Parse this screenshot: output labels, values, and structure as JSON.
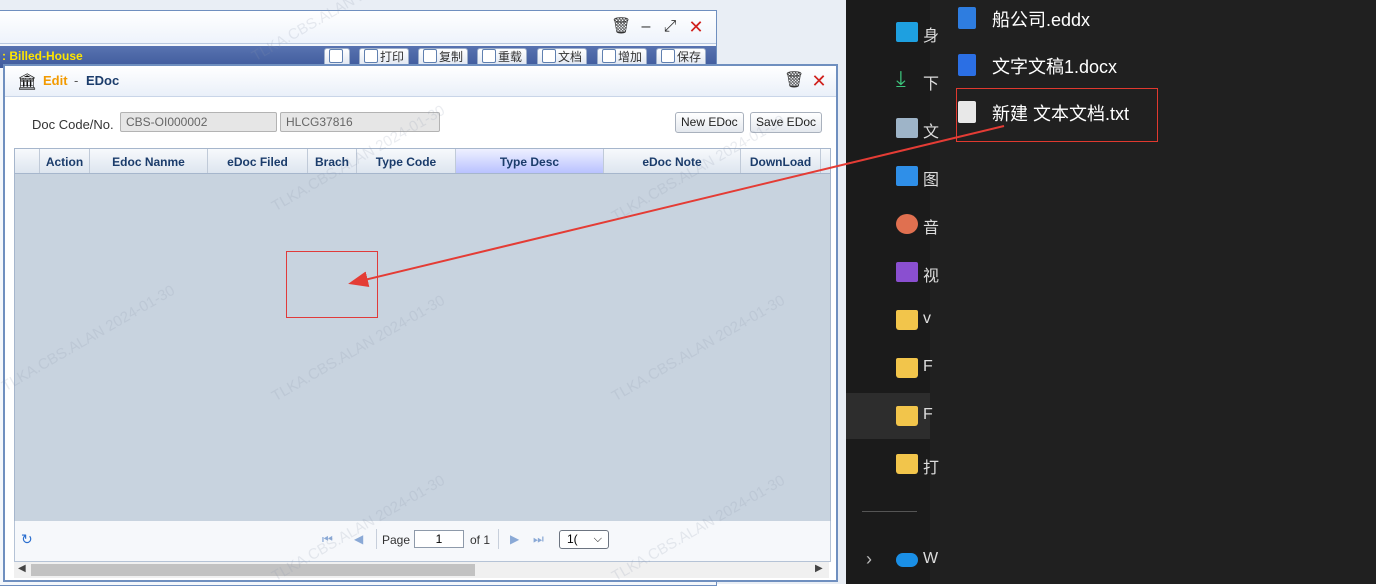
{
  "back_window": {
    "title": "Billed-House",
    "title_prefix": ":",
    "toolbar": [
      "打印",
      "复制",
      "重载",
      "文档",
      "增加",
      "保存"
    ]
  },
  "dialog": {
    "mode": "Edit",
    "separator": "-",
    "title": "EDoc",
    "doc_label": "Doc Code/No.",
    "doc_code": "CBS-OI000002",
    "doc_no": "HLCG37816",
    "new_button": "New EDoc",
    "save_button": "Save EDoc",
    "columns": [
      "Action",
      "Edoc Nanme",
      "eDoc Filed",
      "Brach",
      "Type Code",
      "Type Desc",
      "eDoc Note",
      "DownLoad"
    ],
    "active_column": "Type Desc",
    "pager": {
      "page_label": "Page",
      "page_value": "1",
      "of_label": "of 1",
      "page_size": "1("
    }
  },
  "watermark": [
    "TLKA.CBS.ALAN 2024-01-30"
  ],
  "explorer": {
    "files": [
      {
        "name": "船公司.eddx",
        "color": "#2e7de0"
      },
      {
        "name": "文字文稿1.docx",
        "color": "#2b6fe4"
      },
      {
        "name": "新建 文本文档.txt",
        "color": "#e8e8e8"
      }
    ],
    "nav": [
      {
        "label": "身",
        "icon": "desktop-icon"
      },
      {
        "label": "下",
        "icon": "download-icon"
      },
      {
        "label": "文",
        "icon": "documents-icon"
      },
      {
        "label": "图",
        "icon": "pictures-icon"
      },
      {
        "label": "音",
        "icon": "music-icon"
      },
      {
        "label": "视",
        "icon": "videos-icon"
      },
      {
        "label": "v",
        "icon": "folder-icon"
      },
      {
        "label": "F",
        "icon": "folder-icon"
      },
      {
        "label": "F",
        "icon": "folder-icon"
      },
      {
        "label": "打",
        "icon": "folder-icon"
      },
      {
        "label": "W",
        "icon": "onedrive-icon"
      }
    ]
  }
}
